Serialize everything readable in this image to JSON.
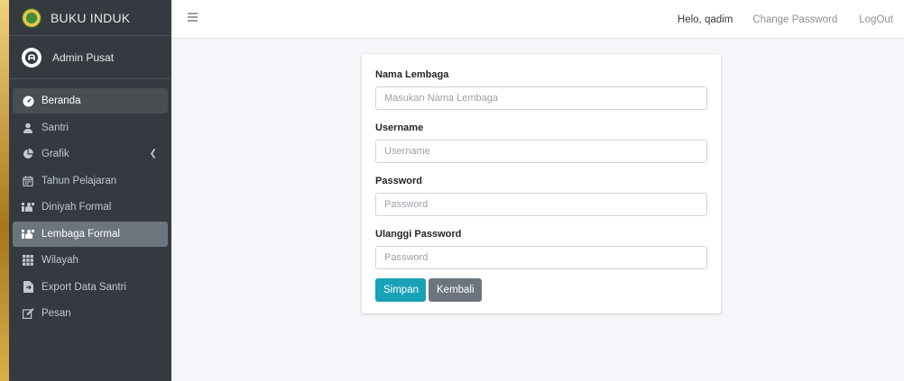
{
  "brand": {
    "title": "BUKU INDUK"
  },
  "user": {
    "name": "Admin Pusat"
  },
  "sidebar": {
    "items": [
      {
        "label": "Beranda",
        "icon": "dashboard-icon"
      },
      {
        "label": "Santri",
        "icon": "user-icon"
      },
      {
        "label": "Grafik",
        "icon": "pie-chart-icon",
        "has_caret": true
      },
      {
        "label": "Tahun Pelajaran",
        "icon": "calendar-icon"
      },
      {
        "label": "Diniyah Formal",
        "icon": "people-group-icon"
      },
      {
        "label": "Lembaga Formal",
        "icon": "people-group-icon"
      },
      {
        "label": "Wilayah",
        "icon": "grid-icon"
      },
      {
        "label": "Export Data Santri",
        "icon": "file-export-icon"
      },
      {
        "label": "Pesan",
        "icon": "edit-icon"
      }
    ]
  },
  "topbar": {
    "greeting": "Helo, qadim",
    "change_password": "Change Password",
    "logout": "LogOut"
  },
  "form": {
    "nama_lembaga": {
      "label": "Nama Lembaga",
      "placeholder": "Masukan Nama Lembaga"
    },
    "username": {
      "label": "Username",
      "placeholder": "Username"
    },
    "password": {
      "label": "Password",
      "placeholder": "Password"
    },
    "ulangi_password": {
      "label": "Ulanggi Password",
      "placeholder": "Password"
    },
    "save_label": "Simpan",
    "back_label": "Kembali"
  },
  "colors": {
    "sidebar_bg": "#343a40",
    "accent_info": "#17a2b8",
    "secondary": "#6c757d"
  }
}
